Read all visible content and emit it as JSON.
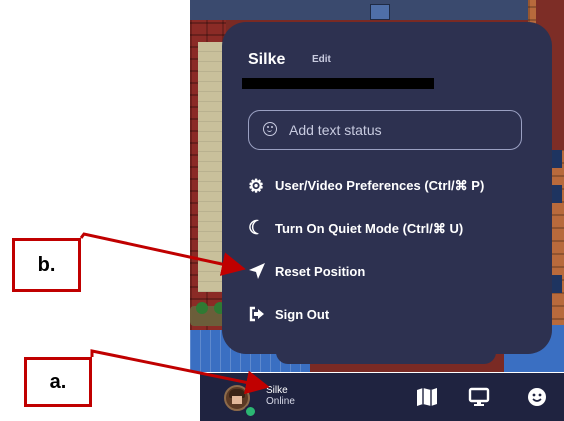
{
  "menu": {
    "username": "Silke",
    "edit_label": "Edit",
    "status_placeholder": "Add text status",
    "items": [
      {
        "label": "User/Video Preferences (Ctrl/⌘ P)",
        "icon": "gear-icon"
      },
      {
        "label": "Turn On Quiet Mode (Ctrl/⌘ U)",
        "icon": "moon-icon"
      },
      {
        "label": "Reset Position",
        "icon": "location-arrow-icon"
      },
      {
        "label": "Sign Out",
        "icon": "sign-out-icon"
      }
    ]
  },
  "bottom_bar": {
    "name": "Silke",
    "status": "Online",
    "icons": [
      "map-icon",
      "screen-icon",
      "emoji-icon"
    ]
  },
  "annotations": {
    "a": "a.",
    "b": "b.",
    "color": "#c00000"
  },
  "colors": {
    "menu_bg": "#2d3150",
    "bar_bg": "#1f2340",
    "online": "#2bb673"
  }
}
